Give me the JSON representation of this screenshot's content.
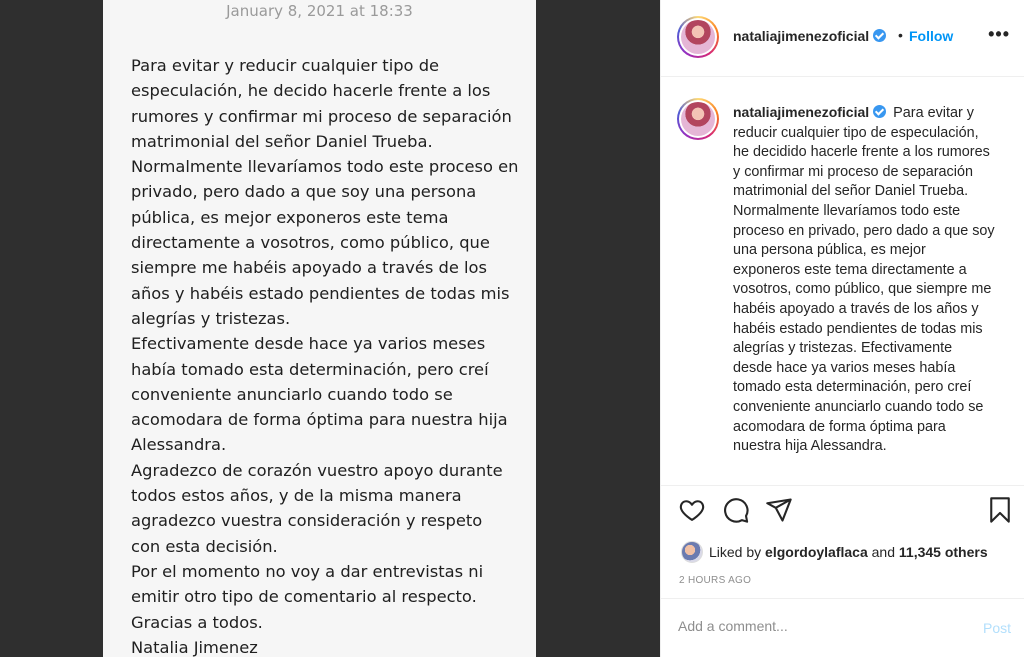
{
  "note": {
    "date": "January 8, 2021 at 18:33",
    "lines": [
      "Para evitar y reducir cualquier tipo de",
      "especulación, he decido hacerle frente a los",
      "rumores y confirmar mi proceso de separación",
      "matrimonial del señor Daniel Trueba.",
      "Normalmente llevaríamos todo este proceso en",
      "privado, pero dado a que soy una persona",
      "pública, es mejor exponeros este tema",
      "directamente a vosotros, como público, que",
      "siempre me habéis apoyado a través de los",
      "años y habéis estado pendientes de todas mis",
      "alegrías y tristezas.",
      "Efectivamente desde hace ya varios meses",
      "había tomado esta determinación, pero creí",
      "conveniente anunciarlo cuando todo se",
      "acomodara de forma óptima para nuestra hija",
      "Alessandra.",
      "Agradezco de corazón vuestro apoyo durante",
      "todos estos años, y de la misma manera",
      "agradezco vuestra consideración y respeto",
      "con esta decisión.",
      "Por el momento no voy a dar entrevistas ni",
      "emitir otro tipo de comentario al respecto.",
      "Gracias a todos.",
      "Natalia Jimenez"
    ]
  },
  "post": {
    "username": "nataliajimenezoficial",
    "follow_sep": "•",
    "follow_label": "Follow",
    "more_label": "•••",
    "caption_text": "Para evitar y reducir cualquier tipo de especulación, he decidido hacerle frente a los rumores y confirmar mi proceso de separación matrimonial del señor Daniel Trueba. Normalmente llevaríamos todo este proceso en privado, pero dado a que soy una persona pública, es mejor exponeros este tema directamente a vosotros, como público, que siempre me habéis apoyado a través de los años y habéis estado pendientes de todas mis alegrías y tristezas. Efectivamente desde hace ya varios meses había tomado esta determinación, pero creí conveniente anunciarlo cuando todo se acomodara de forma óptima para nuestra hija Alessandra.",
    "likes_prefix": "Liked by",
    "likes_user": "elgordoylaflaca",
    "likes_and": "and",
    "likes_others": "11,345 others",
    "time": "2 HOURS AGO",
    "comment_placeholder": "Add a comment...",
    "post_label": "Post"
  },
  "colors": {
    "accent": "#0095f6",
    "post_disabled": "#b2dffc",
    "verified": "#3897f0"
  },
  "icons": [
    "heart-icon",
    "comment-icon",
    "share-icon",
    "bookmark-icon",
    "verified-badge-icon",
    "more-options-icon"
  ]
}
